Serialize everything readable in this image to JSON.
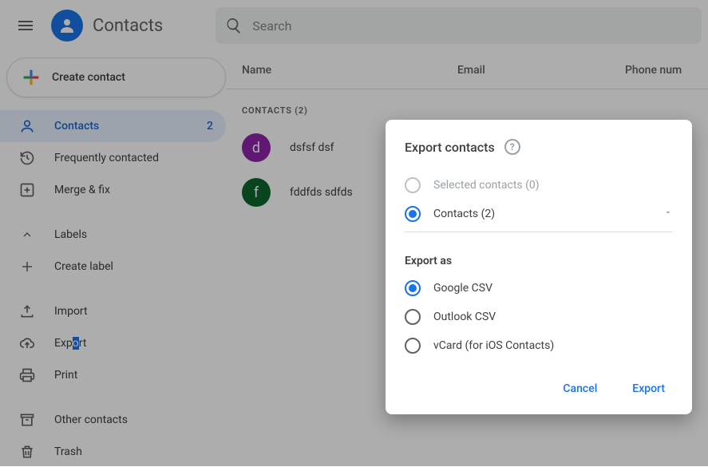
{
  "header": {
    "app_title": "Contacts",
    "search_placeholder": "Search"
  },
  "sidebar": {
    "create_label": "Create contact",
    "items_main": [
      {
        "label": "Contacts",
        "count": "2",
        "active": true
      },
      {
        "label": "Frequently contacted"
      },
      {
        "label": "Merge & fix"
      }
    ],
    "labels_header": "Labels",
    "create_label_action": "Create label",
    "items_tools": [
      {
        "label": "Import"
      },
      {
        "label": "Export",
        "pre": "Exp",
        "hl": "o",
        "post": "rt"
      },
      {
        "label": "Print"
      }
    ],
    "items_bottom": [
      {
        "label": "Other contacts"
      },
      {
        "label": "Trash"
      }
    ]
  },
  "main": {
    "columns": {
      "name": "Name",
      "email": "Email",
      "phone": "Phone num"
    },
    "group_label": "CONTACTS (2)",
    "rows": [
      {
        "initial": "d",
        "name": "dsfsf dsf"
      },
      {
        "initial": "f",
        "name": "fddfds sdfds"
      }
    ]
  },
  "dialog": {
    "title": "Export contacts",
    "opt_selected": "Selected contacts (0)",
    "opt_contacts": "Contacts (2)",
    "export_as_label": "Export as",
    "fmt_google": "Google CSV",
    "fmt_outlook": "Outlook CSV",
    "fmt_vcard": "vCard (for iOS Contacts)",
    "cancel": "Cancel",
    "export": "Export"
  }
}
